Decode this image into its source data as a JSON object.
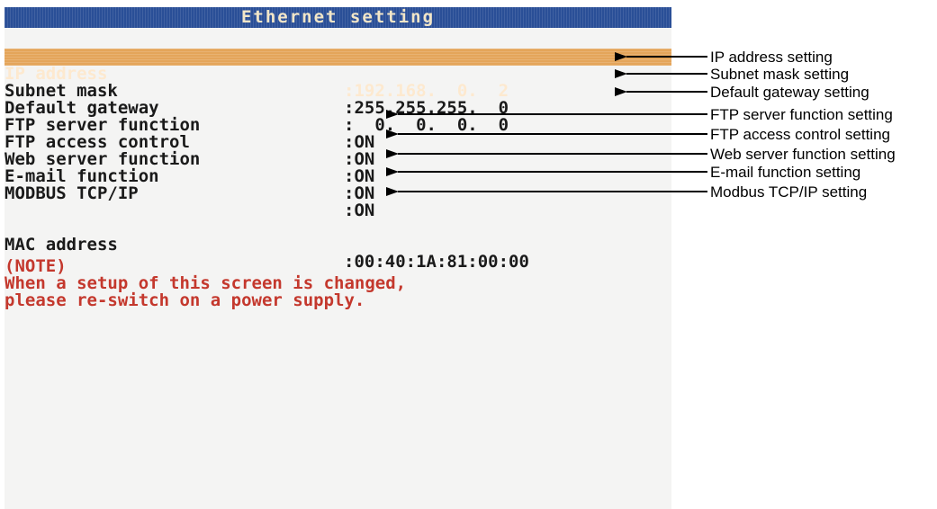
{
  "screen": {
    "title": "Ethernet setting",
    "rows": [
      {
        "label": "IP address",
        "value": ":192.168.  0.  2"
      },
      {
        "label": "Subnet mask",
        "value": ":255.255.255.  0"
      },
      {
        "label": "Default gateway",
        "value": ":  0.  0.  0.  0"
      },
      {
        "label": "FTP server function",
        "value": ":ON"
      },
      {
        "label": "FTP access control",
        "value": ":ON"
      },
      {
        "label": "Web server function",
        "value": ":ON"
      },
      {
        "label": "E-mail function",
        "value": ":ON"
      },
      {
        "label": "MODBUS TCP/IP",
        "value": ":ON"
      }
    ],
    "mac": {
      "label": "MAC address",
      "value": ":00:40:1A:81:00:00"
    },
    "note": {
      "heading": "(NOTE)",
      "line1": "When a setup of this screen is changed,",
      "line2": "please re-switch on a power supply."
    }
  },
  "callouts": [
    "IP address setting",
    "Subnet mask setting",
    "Default gateway setting",
    "FTP server function setting",
    "FTP access control setting",
    "Web server function setting",
    "E-mail function setting",
    "Modbus TCP/IP setting"
  ],
  "colors": {
    "title_bar": "#2a4f97",
    "selected_row": "#e4a55a",
    "note_text": "#c4382d",
    "screen_background": "#f4f4f3"
  }
}
